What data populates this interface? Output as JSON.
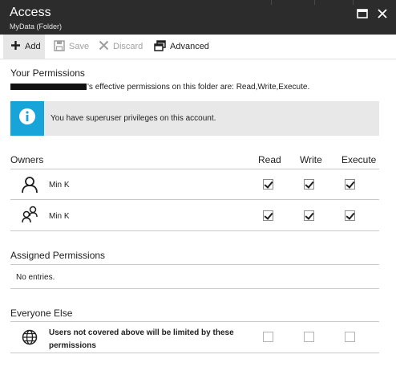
{
  "header": {
    "title": "Access",
    "subtitle": "MyData (Folder)"
  },
  "toolbar": {
    "add_label": "Add",
    "save_label": "Save",
    "discard_label": "Discard",
    "advanced_label": "Advanced"
  },
  "your_permissions": {
    "heading": "Your Permissions",
    "effective_text": "'s effective permissions on this folder are: Read,Write,Execute.",
    "info_message": "You have superuser privileges on this account."
  },
  "owners": {
    "heading": "Owners",
    "columns": [
      "Read",
      "Write",
      "Execute"
    ],
    "rows": [
      {
        "name": "Min K",
        "icon": "user-icon",
        "read": true,
        "write": true,
        "execute": true
      },
      {
        "name": "Min K",
        "icon": "group-icon",
        "read": true,
        "write": true,
        "execute": true
      }
    ]
  },
  "assigned": {
    "heading": "Assigned Permissions",
    "empty_text": "No entries."
  },
  "everyone_else": {
    "heading": "Everyone Else",
    "text": "Users not covered above will be limited by these permissions",
    "read": false,
    "write": false,
    "execute": false
  },
  "colors": {
    "header_bg": "#2c2c2c",
    "info_accent": "#17a4d9",
    "info_bg": "#e8e8e8"
  }
}
